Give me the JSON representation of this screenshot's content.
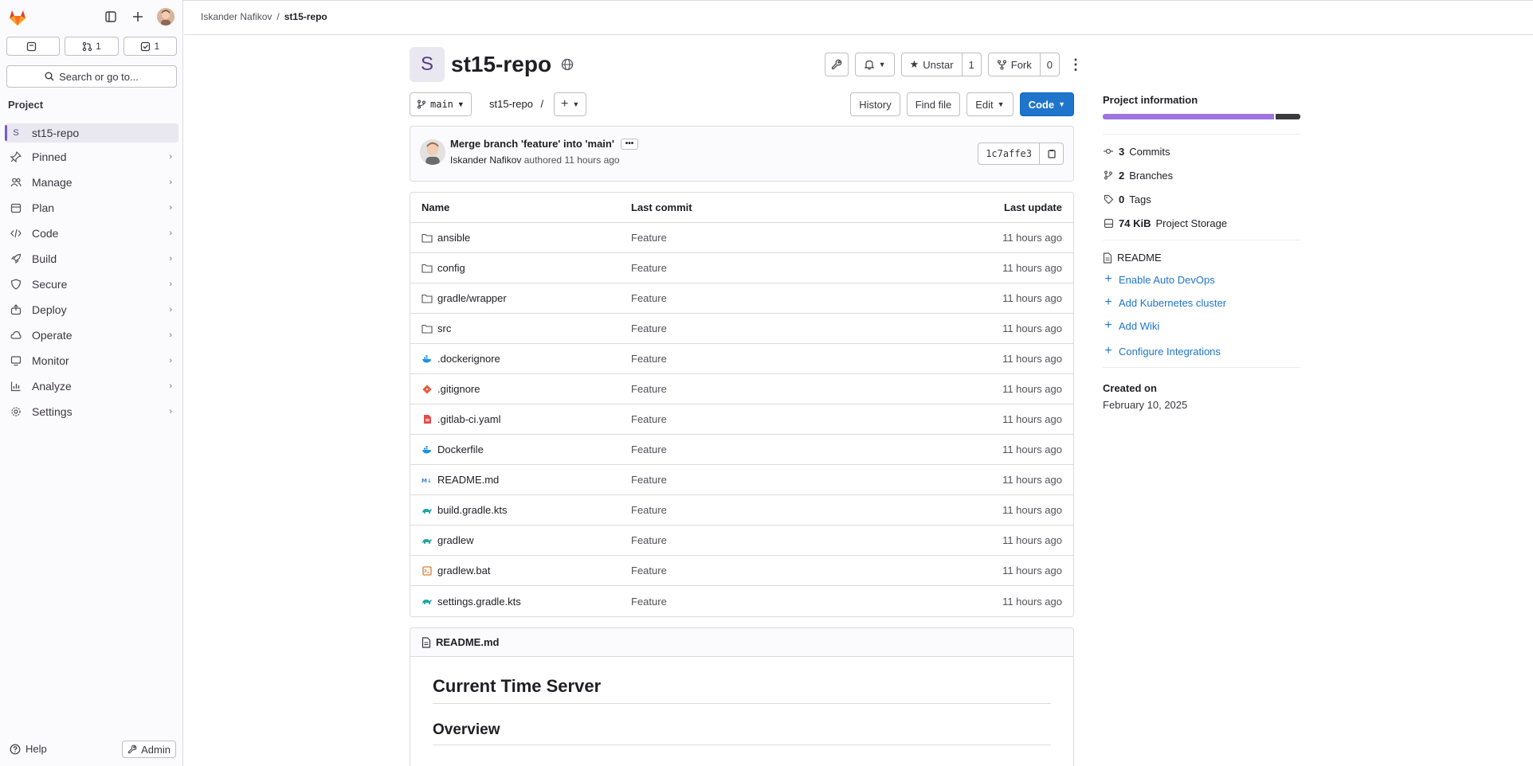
{
  "sidebar": {
    "counters": [
      {
        "icon": "issues-icon",
        "value": ""
      },
      {
        "icon": "merge-request-icon",
        "value": "1"
      },
      {
        "icon": "todo-icon",
        "value": "1"
      }
    ],
    "search_label": "Search or go to...",
    "section_label": "Project",
    "project_item": "st15-repo",
    "project_initial": "S",
    "items": [
      {
        "label": "Pinned",
        "icon": "pin-icon"
      },
      {
        "label": "Manage",
        "icon": "users-icon"
      },
      {
        "label": "Plan",
        "icon": "calendar-icon"
      },
      {
        "label": "Code",
        "icon": "code-icon"
      },
      {
        "label": "Build",
        "icon": "rocket-icon"
      },
      {
        "label": "Secure",
        "icon": "shield-icon"
      },
      {
        "label": "Deploy",
        "icon": "deploy-icon"
      },
      {
        "label": "Operate",
        "icon": "cloud-icon"
      },
      {
        "label": "Monitor",
        "icon": "monitor-icon"
      },
      {
        "label": "Analyze",
        "icon": "chart-icon"
      },
      {
        "label": "Settings",
        "icon": "gear-icon"
      }
    ],
    "help_label": "Help",
    "admin_label": "Admin"
  },
  "breadcrumb": {
    "owner": "Iskander Nafikov",
    "sep": "/",
    "project": "st15-repo"
  },
  "project": {
    "initial": "S",
    "title": "st15-repo",
    "unstar_label": "Unstar",
    "star_count": "1",
    "fork_label": "Fork",
    "fork_count": "0"
  },
  "repo": {
    "branch": "main",
    "path": "st15-repo",
    "path_sep": "/",
    "history_label": "History",
    "find_file_label": "Find file",
    "edit_label": "Edit",
    "code_label": "Code"
  },
  "commit": {
    "title": "Merge branch 'feature' into 'main'",
    "author": "Iskander Nafikov",
    "authored_text": "authored",
    "time": "11 hours ago",
    "sha": "1c7affe3"
  },
  "files": {
    "headers": {
      "name": "Name",
      "commit": "Last commit",
      "update": "Last update"
    },
    "rows": [
      {
        "name": "ansible",
        "type": "folder",
        "commit": "Feature",
        "update": "11 hours ago"
      },
      {
        "name": "config",
        "type": "folder",
        "commit": "Feature",
        "update": "11 hours ago"
      },
      {
        "name": "gradle/wrapper",
        "type": "folder",
        "commit": "Feature",
        "update": "11 hours ago"
      },
      {
        "name": "src",
        "type": "folder",
        "commit": "Feature",
        "update": "11 hours ago"
      },
      {
        "name": ".dockerignore",
        "type": "docker",
        "commit": "Feature",
        "update": "11 hours ago"
      },
      {
        "name": ".gitignore",
        "type": "git",
        "commit": "Feature",
        "update": "11 hours ago"
      },
      {
        "name": ".gitlab-ci.yaml",
        "type": "yaml",
        "commit": "Feature",
        "update": "11 hours ago"
      },
      {
        "name": "Dockerfile",
        "type": "docker",
        "commit": "Feature",
        "update": "11 hours ago"
      },
      {
        "name": "README.md",
        "type": "markdown",
        "commit": "Feature",
        "update": "11 hours ago"
      },
      {
        "name": "build.gradle.kts",
        "type": "gradle",
        "commit": "Feature",
        "update": "11 hours ago"
      },
      {
        "name": "gradlew",
        "type": "gradle",
        "commit": "Feature",
        "update": "11 hours ago"
      },
      {
        "name": "gradlew.bat",
        "type": "bat",
        "commit": "Feature",
        "update": "11 hours ago"
      },
      {
        "name": "settings.gradle.kts",
        "type": "gradle",
        "commit": "Feature",
        "update": "11 hours ago"
      }
    ]
  },
  "readme": {
    "filename": "README.md",
    "h1": "Current Time Server",
    "h2": "Overview"
  },
  "info": {
    "title": "Project information",
    "stats": [
      {
        "icon": "commit-icon",
        "count": "3",
        "label": "Commits"
      },
      {
        "icon": "branch-icon",
        "count": "2",
        "label": "Branches"
      },
      {
        "icon": "tag-icon",
        "count": "0",
        "label": "Tags"
      },
      {
        "icon": "storage-icon",
        "count": "74 KiB",
        "label": "Project Storage"
      }
    ],
    "readme_label": "README",
    "links": [
      "Enable Auto DevOps",
      "Add Kubernetes cluster",
      "Add Wiki",
      "Configure Integrations"
    ],
    "created_label": "Created on",
    "created_date": "February 10, 2025"
  },
  "colors": {
    "accent": "#1f75cb",
    "storage_used": "#9e75e0",
    "brand": "#e24329"
  }
}
